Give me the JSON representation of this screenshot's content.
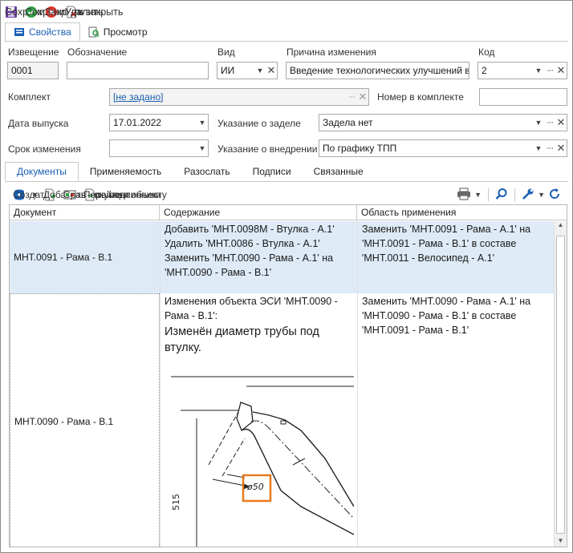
{
  "toolbar": {
    "save": "Сохранить",
    "save_close": "Сохранить и закрыть",
    "close": "Закрыть",
    "delete": "Удалить"
  },
  "tabs": {
    "properties": "Свойства",
    "preview": "Просмотр"
  },
  "form": {
    "notice_label": "Извещение",
    "notice_value": "0001",
    "designation_label": "Обозначение",
    "designation_value": "",
    "type_label": "Вид",
    "type_value": "ИИ",
    "reason_label": "Причина изменения",
    "reason_value": "Введение технологических улучшений в",
    "code_label": "Код",
    "code_value": "2",
    "kit_label": "Комплект",
    "kit_value": "[не задано]",
    "kit_number_label": "Номер в комплекте",
    "kit_number_value": "",
    "issue_date_label": "Дата выпуска",
    "issue_date_value": "17.01.2022",
    "backlog_label": "Указание о заделе",
    "backlog_value": "Задела нет",
    "change_term_label": "Срок изменения",
    "change_term_value": "",
    "implementation_label": "Указание о внедрении",
    "implementation_value": "По графику ТПП"
  },
  "subtabs": {
    "documents": "Документы",
    "applicability": "Применяемость",
    "send": "Разослать",
    "signatures": "Подписи",
    "related": "Связанные"
  },
  "doc_toolbar": {
    "create": "Создать",
    "add_document": "Добавить документ",
    "compare": "Сравнить подлинники",
    "goto": "Перейти к объекту"
  },
  "grid": {
    "headers": [
      "Документ",
      "Содержание",
      "Область применения"
    ],
    "rows": [
      {
        "document": "МНТ.0091 - Рама - В.1",
        "content": "Добавить 'МНТ.0098М - Втулка - А.1' Удалить 'МНТ.0086 - Втулка - А.1' Заменить 'МНТ.0090 - Рама - А.1' на 'МНТ.0090 - Рама - В.1'",
        "scope": "Заменить 'МНТ.0091 - Рама - А.1' на 'МНТ.0091 - Рама - В.1' в составе 'МНТ.0011 - Велосипед - А.1'"
      },
      {
        "document": "МНТ.0090 - Рама - В.1",
        "content": "Изменения объекта ЭСИ 'МНТ.0090 - Рама - В.1':",
        "content_note": "Изменён диаметр трубы под втулку.",
        "scope": "Заменить 'МНТ.0090 - Рама - А.1' на 'МНТ.0090 - Рама - В.1' в составе 'МНТ.0091 - Рама - В.1'"
      }
    ]
  },
  "drawing": {
    "diameter_label": "ø50",
    "dimension_label": "515"
  },
  "colors": {
    "accent": "#1a5fb4",
    "selected_row": "#deebf7",
    "highlight_box": "#e87a1e"
  }
}
